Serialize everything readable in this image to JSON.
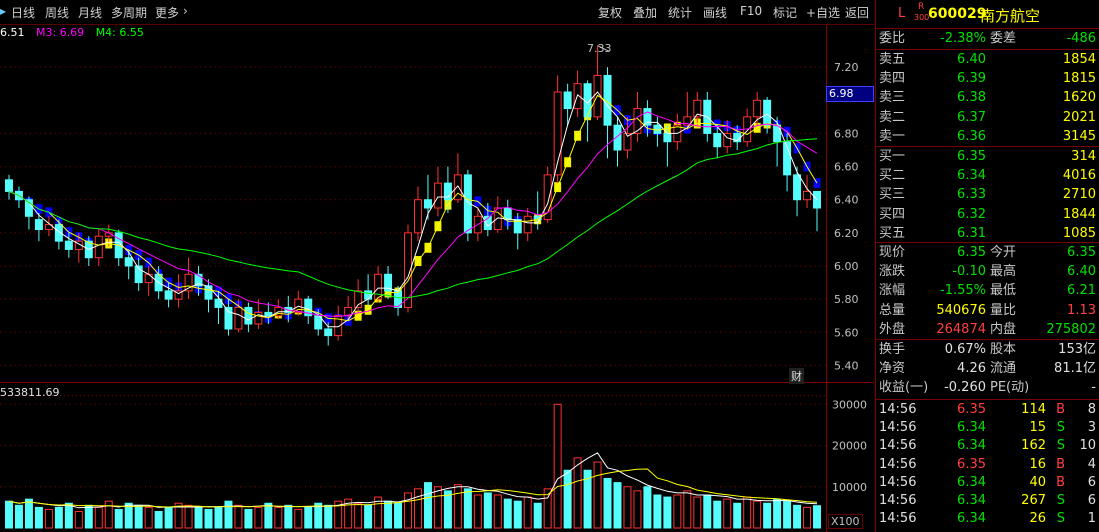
{
  "toolbar": {
    "tabs": [
      "日线",
      "周线",
      "月线",
      "多周期",
      "更多"
    ],
    "buttons": [
      "复权",
      "叠加",
      "统计",
      "画线",
      "F10",
      "标记",
      "+自选",
      "返回"
    ]
  },
  "indicators": {
    "ma_label_partial": "6.51",
    "m3": "M3: 6.69",
    "m4": "M4: 6.55",
    "vol_label": "533811.69",
    "peak_label": "7.33",
    "current_price_tag": "6.98",
    "cai_label": "财",
    "vol_unit": "X100"
  },
  "price_axis": {
    "labels": [
      "7.20",
      "6.80",
      "6.60",
      "6.40",
      "6.20",
      "6.00",
      "5.80",
      "5.60",
      "5.40"
    ]
  },
  "vol_axis": {
    "labels": [
      "30000",
      "20000",
      "10000"
    ]
  },
  "stock": {
    "mark": "L",
    "badge_top": "R",
    "badge_bottom": "300",
    "code": "600029",
    "name": "南方航空"
  },
  "ratio": {
    "label1": "委比",
    "val1": "-2.38%",
    "label2": "委差",
    "val2": "-486"
  },
  "asks": [
    {
      "label": "卖五",
      "price": "6.40",
      "vol": "1854"
    },
    {
      "label": "卖四",
      "price": "6.39",
      "vol": "1815"
    },
    {
      "label": "卖三",
      "price": "6.38",
      "vol": "1620"
    },
    {
      "label": "卖二",
      "price": "6.37",
      "vol": "2021"
    },
    {
      "label": "卖一",
      "price": "6.36",
      "vol": "3145"
    }
  ],
  "bids": [
    {
      "label": "买一",
      "price": "6.35",
      "vol": "314"
    },
    {
      "label": "买二",
      "price": "6.34",
      "vol": "4016"
    },
    {
      "label": "买三",
      "price": "6.33",
      "vol": "2710"
    },
    {
      "label": "买四",
      "price": "6.32",
      "vol": "1844"
    },
    {
      "label": "买五",
      "price": "6.31",
      "vol": "1085"
    }
  ],
  "quote": [
    {
      "l1": "现价",
      "v1": "6.35",
      "c1": "green",
      "l2": "今开",
      "v2": "6.35",
      "c2": "green"
    },
    {
      "l1": "涨跌",
      "v1": "-0.10",
      "c1": "green",
      "l2": "最高",
      "v2": "6.40",
      "c2": "green"
    },
    {
      "l1": "涨幅",
      "v1": "-1.55%",
      "c1": "green",
      "l2": "最低",
      "v2": "6.21",
      "c2": "green"
    },
    {
      "l1": "总量",
      "v1": "540676",
      "c1": "yellow",
      "l2": "量比",
      "v2": "1.13",
      "c2": "red"
    },
    {
      "l1": "外盘",
      "v1": "264874",
      "c1": "red",
      "l2": "内盘",
      "v2": "275802",
      "c2": "green"
    }
  ],
  "fundamentals": [
    {
      "l1": "换手",
      "v1": "0.67%",
      "l2": "股本",
      "v2": "153亿"
    },
    {
      "l1": "净资",
      "v1": "4.26",
      "l2": "流通",
      "v2": "81.1亿"
    },
    {
      "l1": "收益(一)",
      "v1": "-0.260",
      "l2": "PE(动)",
      "v2": "-"
    }
  ],
  "ticks": [
    {
      "time": "14:56",
      "price": "6.35",
      "vol": "114",
      "bs": "B",
      "n": "8"
    },
    {
      "time": "14:56",
      "price": "6.34",
      "vol": "15",
      "bs": "S",
      "n": "3"
    },
    {
      "time": "14:56",
      "price": "6.34",
      "vol": "162",
      "bs": "S",
      "n": "10"
    },
    {
      "time": "14:56",
      "price": "6.35",
      "vol": "16",
      "bs": "B",
      "n": "4"
    },
    {
      "time": "14:56",
      "price": "6.34",
      "vol": "40",
      "bs": "B",
      "n": "6"
    },
    {
      "time": "14:56",
      "price": "6.34",
      "vol": "267",
      "bs": "S",
      "n": "6"
    },
    {
      "time": "14:56",
      "price": "6.34",
      "vol": "26",
      "bs": "S",
      "n": "1"
    }
  ],
  "colors": {
    "up": "#ff3232",
    "down": "#54fcfc",
    "ma1": "#ffffff",
    "ma2": "#ffff00",
    "ma3": "#ff00ff",
    "ma4": "#00ff00",
    "grid": "#800000",
    "zone_up": "#ffff00",
    "zone_down": "#0000ff"
  },
  "chart_data": {
    "type": "candlestick",
    "ylim": [
      5.3,
      7.4
    ],
    "candles": [
      [
        6.52,
        6.45,
        6.55,
        6.4
      ],
      [
        6.45,
        6.4,
        6.48,
        6.35
      ],
      [
        6.4,
        6.3,
        6.42,
        6.22
      ],
      [
        6.28,
        6.22,
        6.32,
        6.15
      ],
      [
        6.22,
        6.25,
        6.3,
        6.18
      ],
      [
        6.25,
        6.15,
        6.28,
        6.1
      ],
      [
        6.15,
        6.1,
        6.2,
        6.05
      ],
      [
        6.1,
        6.15,
        6.2,
        6.02
      ],
      [
        6.15,
        6.05,
        6.18,
        6.0
      ],
      [
        6.05,
        6.18,
        6.22,
        6.0
      ],
      [
        6.18,
        6.2,
        6.25,
        6.12
      ],
      [
        6.2,
        6.05,
        6.22,
        6.0
      ],
      [
        6.05,
        6.0,
        6.1,
        5.92
      ],
      [
        6.0,
        5.9,
        6.05,
        5.85
      ],
      [
        5.9,
        5.95,
        6.0,
        5.82
      ],
      [
        5.95,
        5.85,
        6.0,
        5.8
      ],
      [
        5.85,
        5.8,
        5.9,
        5.75
      ],
      [
        5.8,
        5.85,
        5.95,
        5.75
      ],
      [
        5.85,
        5.95,
        6.05,
        5.8
      ],
      [
        5.95,
        5.88,
        6.0,
        5.82
      ],
      [
        5.88,
        5.8,
        5.92,
        5.72
      ],
      [
        5.8,
        5.75,
        5.85,
        5.65
      ],
      [
        5.75,
        5.62,
        5.8,
        5.58
      ],
      [
        5.62,
        5.75,
        5.8,
        5.6
      ],
      [
        5.75,
        5.65,
        5.78,
        5.6
      ],
      [
        5.65,
        5.72,
        5.8,
        5.62
      ],
      [
        5.72,
        5.7,
        5.78,
        5.65
      ],
      [
        5.7,
        5.75,
        5.8,
        5.68
      ],
      [
        5.75,
        5.72,
        5.82,
        5.66
      ],
      [
        5.72,
        5.8,
        5.85,
        5.7
      ],
      [
        5.8,
        5.7,
        5.82,
        5.65
      ],
      [
        5.7,
        5.62,
        5.74,
        5.58
      ],
      [
        5.62,
        5.58,
        5.66,
        5.52
      ],
      [
        5.58,
        5.7,
        5.76,
        5.55
      ],
      [
        5.7,
        5.75,
        5.82,
        5.68
      ],
      [
        5.75,
        5.85,
        5.92,
        5.72
      ],
      [
        5.85,
        5.8,
        5.95,
        5.76
      ],
      [
        5.8,
        5.95,
        6.0,
        5.78
      ],
      [
        5.95,
        5.85,
        6.0,
        5.8
      ],
      [
        5.85,
        5.75,
        5.88,
        5.7
      ],
      [
        5.75,
        6.2,
        6.25,
        5.72
      ],
      [
        6.2,
        6.4,
        6.48,
        6.15
      ],
      [
        6.4,
        6.35,
        6.55,
        6.28
      ],
      [
        6.35,
        6.5,
        6.6,
        6.3
      ],
      [
        6.5,
        6.4,
        6.6,
        6.32
      ],
      [
        6.4,
        6.55,
        6.68,
        6.38
      ],
      [
        6.55,
        6.2,
        6.58,
        6.15
      ],
      [
        6.2,
        6.3,
        6.35,
        6.15
      ],
      [
        6.3,
        6.22,
        6.38,
        6.18
      ],
      [
        6.22,
        6.35,
        6.42,
        6.2
      ],
      [
        6.35,
        6.28,
        6.4,
        6.22
      ],
      [
        6.28,
        6.2,
        6.32,
        6.1
      ],
      [
        6.2,
        6.3,
        6.35,
        6.15
      ],
      [
        6.3,
        6.28,
        6.45,
        6.22
      ],
      [
        6.28,
        6.55,
        6.6,
        6.26
      ],
      [
        6.55,
        7.05,
        7.15,
        6.5
      ],
      [
        7.05,
        6.95,
        7.1,
        6.85
      ],
      [
        6.95,
        7.1,
        7.18,
        6.9
      ],
      [
        7.1,
        6.9,
        7.12,
        6.75
      ],
      [
        6.9,
        7.15,
        7.33,
        6.88
      ],
      [
        7.15,
        6.85,
        7.2,
        6.65
      ],
      [
        6.85,
        6.7,
        6.9,
        6.6
      ],
      [
        6.7,
        6.8,
        6.9,
        6.65
      ],
      [
        6.8,
        6.95,
        7.05,
        6.75
      ],
      [
        6.95,
        6.85,
        7.0,
        6.78
      ],
      [
        6.85,
        6.8,
        6.9,
        6.72
      ],
      [
        6.8,
        6.75,
        6.85,
        6.6
      ],
      [
        6.75,
        6.85,
        6.92,
        6.7
      ],
      [
        6.85,
        6.9,
        7.05,
        6.82
      ],
      [
        6.9,
        7.0,
        7.05,
        6.85
      ],
      [
        7.0,
        6.8,
        7.05,
        6.75
      ],
      [
        6.8,
        6.72,
        6.85,
        6.65
      ],
      [
        6.72,
        6.8,
        6.88,
        6.68
      ],
      [
        6.8,
        6.75,
        6.85,
        6.7
      ],
      [
        6.75,
        6.9,
        6.95,
        6.72
      ],
      [
        6.9,
        7.0,
        7.05,
        6.85
      ],
      [
        7.0,
        6.85,
        7.02,
        6.8
      ],
      [
        6.85,
        6.75,
        6.9,
        6.6
      ],
      [
        6.75,
        6.55,
        6.8,
        6.45
      ],
      [
        6.55,
        6.4,
        6.6,
        6.3
      ],
      [
        6.4,
        6.45,
        6.55,
        6.35
      ],
      [
        6.45,
        6.35,
        6.4,
        6.21
      ]
    ],
    "volume": [
      6500,
      5500,
      7000,
      5000,
      4500,
      5000,
      6000,
      4000,
      5500,
      5000,
      6500,
      4500,
      6000,
      5500,
      5000,
      4000,
      5000,
      6000,
      5500,
      5000,
      4500,
      5000,
      6500,
      5500,
      4500,
      5000,
      6000,
      5000,
      5500,
      4500,
      5000,
      6000,
      5500,
      6500,
      7000,
      6000,
      5500,
      7500,
      6500,
      6000,
      8500,
      9500,
      11000,
      10000,
      9000,
      10500,
      9500,
      8000,
      8500,
      8000,
      7000,
      6500,
      7500,
      6000,
      9500,
      30000,
      14000,
      17000,
      14000,
      16000,
      12000,
      11000,
      10000,
      9000,
      10000,
      8000,
      7500,
      8000,
      9000,
      7500,
      8000,
      6500,
      7000,
      6000,
      7500,
      6500,
      6000,
      7000,
      6500,
      5500,
      5000,
      5400
    ]
  }
}
